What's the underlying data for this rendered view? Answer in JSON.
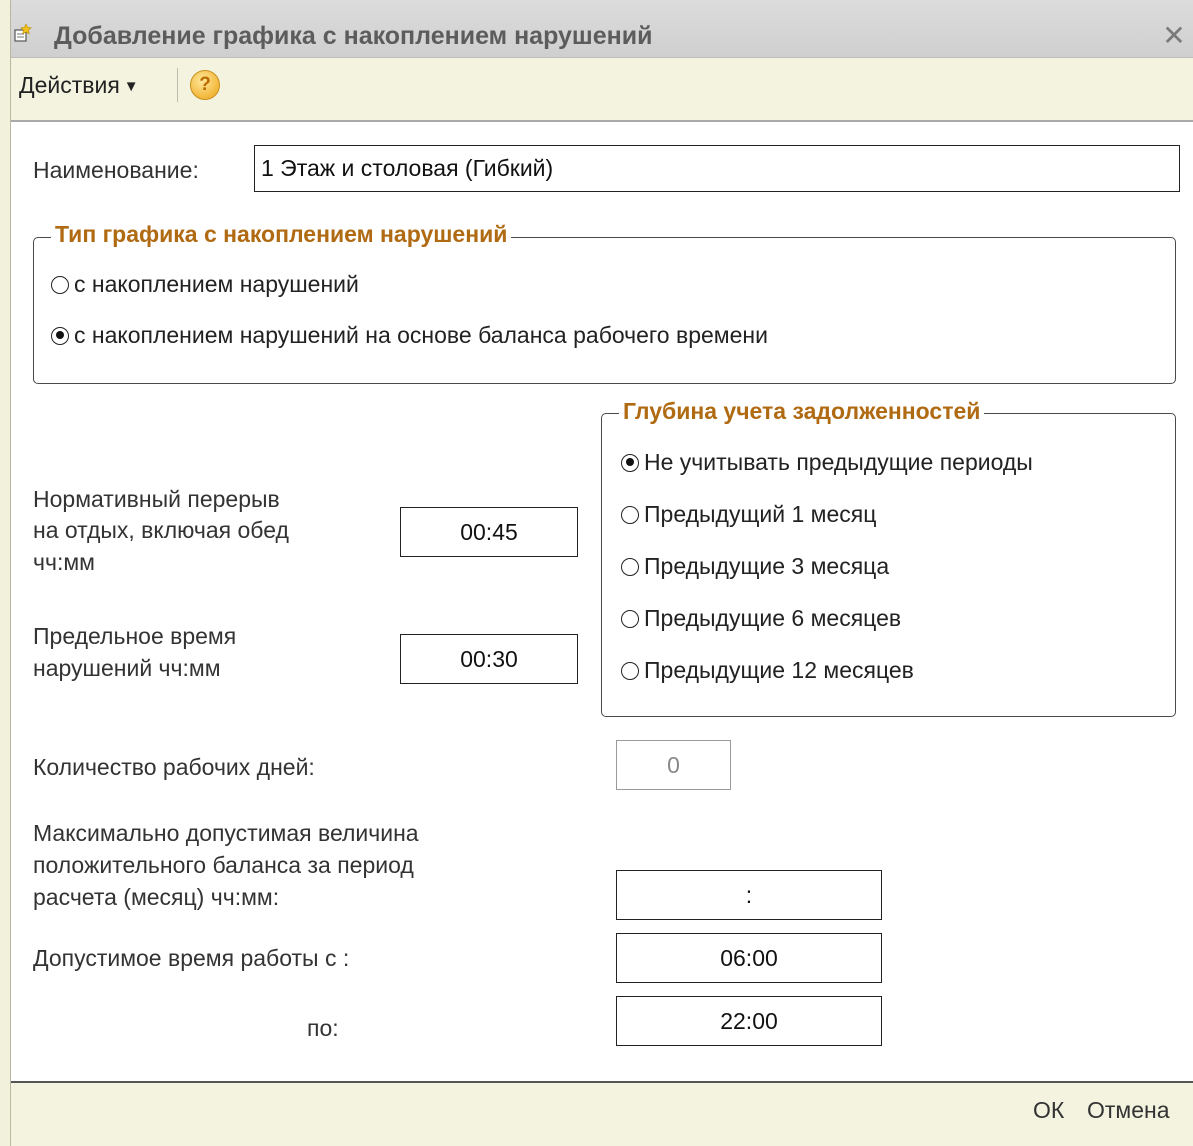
{
  "window": {
    "title": "Добавление  графика с накоплением нарушений",
    "icon": "add-document-icon",
    "close_icon": "close-icon"
  },
  "toolbar": {
    "actions_label": "Действия",
    "help_label": "?"
  },
  "name": {
    "label": "Наименование:",
    "value": "1 Этаж и столовая (Гибкий)"
  },
  "schedule_type": {
    "title": "Тип  графика с накоплением нарушений",
    "options": [
      {
        "label": "с накоплением нарушений",
        "checked": false
      },
      {
        "label": "с накоплением нарушений на основе баланса рабочего времени",
        "checked": true
      }
    ]
  },
  "debt_depth": {
    "title": "Глубина учета задолженностей",
    "options": [
      {
        "label": "Не учитывать предыдущие периоды",
        "checked": true
      },
      {
        "label": "Предыдущий 1 месяц",
        "checked": false
      },
      {
        "label": "Предыдущие 3 месяца",
        "checked": false
      },
      {
        "label": "Предыдущие 6 месяцев",
        "checked": false
      },
      {
        "label": "Предыдущие 12 месяцев",
        "checked": false
      }
    ]
  },
  "break_time": {
    "label_lines": [
      "Нормативный перерыв",
      "на отдых, включая обед",
      "чч:мм"
    ],
    "value": "00:45"
  },
  "violation_limit": {
    "label_lines": [
      "Предельное время",
      "нарушений чч:мм"
    ],
    "value": "00:30"
  },
  "work_days": {
    "label": "Количество рабочих дней:",
    "value": "0"
  },
  "max_balance": {
    "label_lines": [
      "Максимально допустимая величина",
      "положительного баланса за период",
      "расчета (месяц) чч:мм:"
    ],
    "value": ":"
  },
  "work_from": {
    "label": "Допустимое время работы с :",
    "value": "06:00"
  },
  "work_to": {
    "label": "по:",
    "value": "22:00"
  },
  "footer": {
    "ok_label": "ОК",
    "cancel_label": "Отмена"
  }
}
